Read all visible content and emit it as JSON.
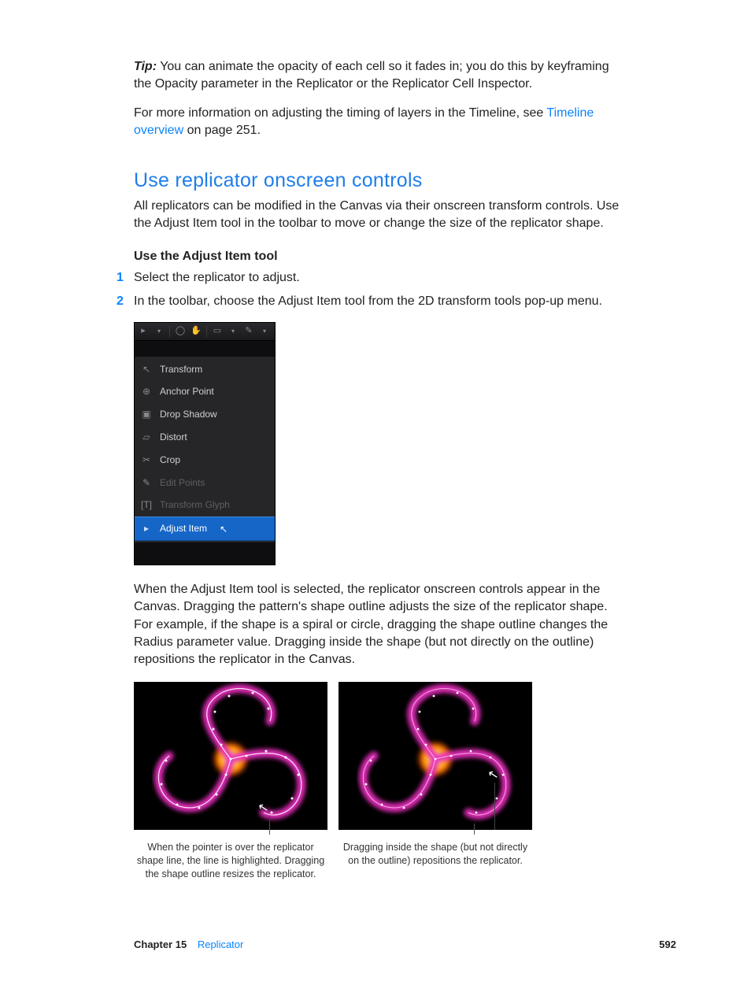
{
  "tip": {
    "label": "Tip:",
    "body": "You can animate the opacity of each cell so it fades in; you do this by keyframing the Opacity parameter in the Replicator or the Replicator Cell Inspector."
  },
  "timeline_sentence": {
    "prefix": "For more information on adjusting the timing of layers in the Timeline, see ",
    "link": "Timeline overview",
    "suffix_before_page": " on page ",
    "page_ref": "251",
    "period": "."
  },
  "section": {
    "title": "Use replicator onscreen controls",
    "intro": "All replicators can be modified in the Canvas via their onscreen transform controls. Use the Adjust Item tool in the toolbar to move or change the size of the replicator shape.",
    "sub_heading": "Use the Adjust Item tool",
    "steps": [
      "Select the replicator to adjust.",
      "In the toolbar, choose the Adjust Item tool from the 2D transform tools pop-up menu."
    ],
    "after_menu": "When the Adjust Item tool is selected, the replicator onscreen controls appear in the Canvas. Dragging the pattern's shape outline adjusts the size of the replicator shape. For example, if the shape is a spiral or circle, dragging the shape outline changes the Radius parameter value. Dragging inside the shape (but not directly on the outline) repositions the replicator in the Canvas."
  },
  "tool_menu": {
    "items": [
      {
        "label": "Transform",
        "icon": "arrow",
        "dim": false
      },
      {
        "label": "Anchor Point",
        "icon": "anchor",
        "dim": false
      },
      {
        "label": "Drop Shadow",
        "icon": "shadow",
        "dim": false
      },
      {
        "label": "Distort",
        "icon": "distort",
        "dim": false
      },
      {
        "label": "Crop",
        "icon": "crop",
        "dim": false
      },
      {
        "label": "Edit Points",
        "icon": "pen",
        "dim": true
      },
      {
        "label": "Transform Glyph",
        "icon": "glyph",
        "dim": true
      },
      {
        "label": "Adjust Item",
        "icon": "arrow-sel",
        "dim": false,
        "selected": true
      }
    ]
  },
  "captions": {
    "left": "When the pointer is over the replicator shape line, the line is highlighted. Dragging the shape outline resizes the replicator.",
    "right": "Dragging inside the shape (but not directly on the outline) repositions the replicator."
  },
  "footer": {
    "chapter": "Chapter 15",
    "section": "Replicator",
    "page": "592"
  }
}
